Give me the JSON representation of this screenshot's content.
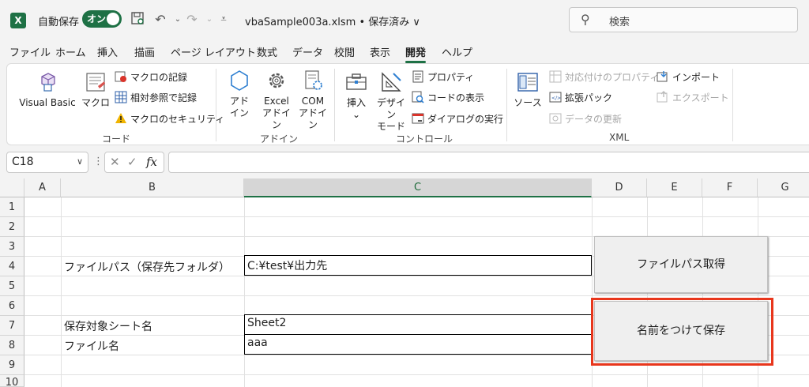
{
  "titlebar": {
    "autosave_label": "自動保存",
    "autosave_toggle": "オン",
    "doc_title": "vbaSample003a.xlsm • 保存済み ∨",
    "search_placeholder": "検索"
  },
  "tabs": [
    "ファイル",
    "ホーム",
    "挿入",
    "描画",
    "ページ レイアウト",
    "数式",
    "データ",
    "校閲",
    "表示",
    "開発",
    "ヘルプ"
  ],
  "active_tab": "開発",
  "ribbon": {
    "code": {
      "label": "コード",
      "visual_basic": "Visual Basic",
      "macro": "マクロ",
      "record_macro": "マクロの記録",
      "relative_ref": "相対参照で記録",
      "macro_security": "マクロのセキュリティ"
    },
    "addins": {
      "label": "アドイン",
      "addin_1": "アド",
      "addin_2": "イン",
      "excel_addin_1": "Excel",
      "excel_addin_2": "アドイン",
      "com_addin_1": "COM",
      "com_addin_2": "アドイン"
    },
    "controls": {
      "label": "コントロール",
      "insert": "挿入",
      "design_mode_1": "デザイン",
      "design_mode_2": "モード",
      "properties": "プロパティ",
      "view_code": "コードの表示",
      "run_dialog": "ダイアログの実行"
    },
    "xml": {
      "label": "XML",
      "source": "ソース",
      "map_properties": "対応付けのプロパティ",
      "expansion_packs": "拡張パック",
      "refresh_data": "データの更新",
      "import": "インポート",
      "export": "エクスポート"
    }
  },
  "formula_bar": {
    "name_box": "C18",
    "fx": "fx",
    "value": ""
  },
  "sheet": {
    "columns": [
      "A",
      "B",
      "C",
      "D",
      "E",
      "F",
      "G"
    ],
    "selected_column": "C",
    "rows": [
      "1",
      "2",
      "3",
      "4",
      "5",
      "6",
      "7",
      "8",
      "9",
      "10"
    ],
    "b4": "ファイルパス（保存先フォルダ）",
    "c4": "C:¥test¥出力先",
    "b7": "保存対象シート名",
    "c7": "Sheet2",
    "b8": "ファイル名",
    "c8": "aaa",
    "btn_get_path": "ファイルパス取得",
    "btn_save_as": "名前をつけて保存"
  },
  "colors": {
    "accent": "#1e7145",
    "highlight": "#e8361c"
  }
}
